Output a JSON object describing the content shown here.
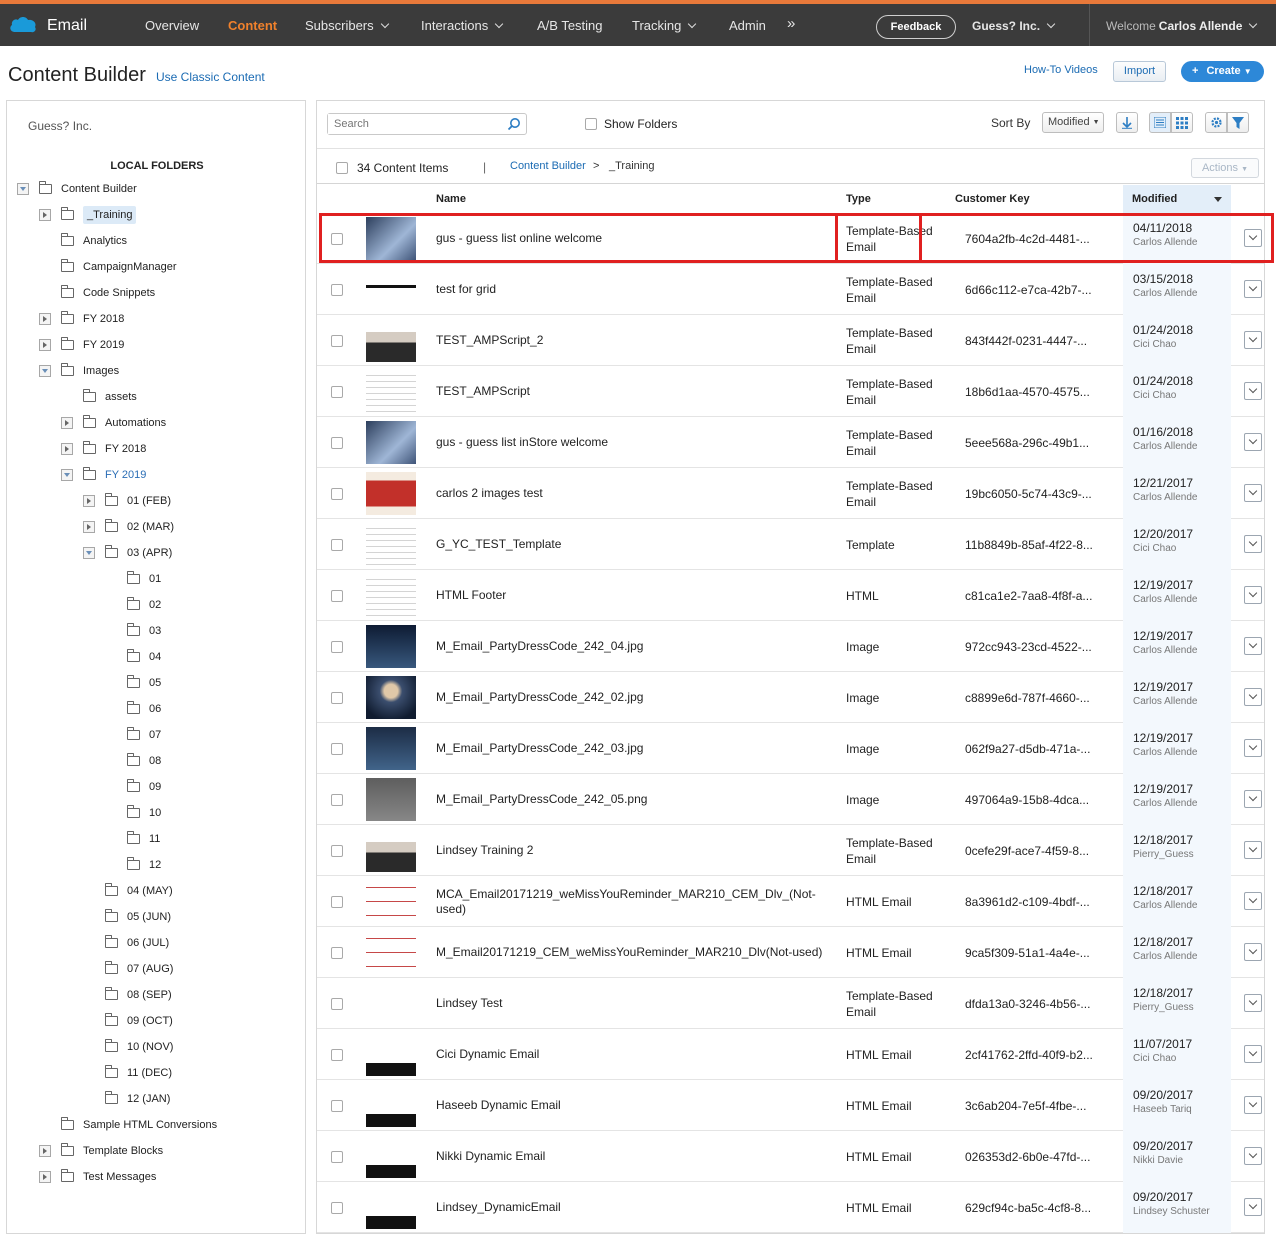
{
  "topnav": {
    "app_title": "Email",
    "items": [
      "Overview",
      "Content",
      "Subscribers",
      "Interactions",
      "A/B Testing",
      "Tracking",
      "Admin"
    ],
    "more": "»",
    "feedback": "Feedback",
    "org": "Guess? Inc.",
    "welcome_label": "Welcome",
    "user": "Carlos Allende",
    "active_color": "#f0812c"
  },
  "header": {
    "title": "Content Builder",
    "classic_link": "Use Classic Content",
    "howto": "How-To Videos",
    "import": "Import",
    "create": "Create",
    "create_icon": "+"
  },
  "sidebar": {
    "org": "Guess? Inc.",
    "heading": "LOCAL FOLDERS",
    "tree": [
      {
        "label": "Content Builder",
        "toggle": "open"
      },
      {
        "label": "_Training",
        "toggle": "closed",
        "selected": true
      },
      {
        "label": "Analytics",
        "toggle": "none"
      },
      {
        "label": "CampaignManager",
        "toggle": "none"
      },
      {
        "label": "Code Snippets",
        "toggle": "none"
      },
      {
        "label": "FY 2018",
        "toggle": "closed"
      },
      {
        "label": "FY 2019",
        "toggle": "closed"
      },
      {
        "label": "Images",
        "toggle": "open"
      },
      {
        "label": "assets",
        "toggle": "none"
      },
      {
        "label": "Automations",
        "toggle": "closed"
      },
      {
        "label": "FY 2018",
        "toggle": "closed"
      },
      {
        "label": "FY 2019",
        "toggle": "open",
        "highlight": true
      },
      {
        "label": "01 (FEB)",
        "toggle": "closed"
      },
      {
        "label": "02 (MAR)",
        "toggle": "closed"
      },
      {
        "label": "03 (APR)",
        "toggle": "open"
      },
      {
        "label": "01",
        "toggle": "none"
      },
      {
        "label": "02",
        "toggle": "none"
      },
      {
        "label": "03",
        "toggle": "none"
      },
      {
        "label": "04",
        "toggle": "none"
      },
      {
        "label": "05",
        "toggle": "none"
      },
      {
        "label": "06",
        "toggle": "none"
      },
      {
        "label": "07",
        "toggle": "none"
      },
      {
        "label": "08",
        "toggle": "none"
      },
      {
        "label": "09",
        "toggle": "none"
      },
      {
        "label": "10",
        "toggle": "none"
      },
      {
        "label": "11",
        "toggle": "none"
      },
      {
        "label": "12",
        "toggle": "none"
      },
      {
        "label": "04 (MAY)",
        "toggle": "none"
      },
      {
        "label": "05 (JUN)",
        "toggle": "none"
      },
      {
        "label": "06 (JUL)",
        "toggle": "none"
      },
      {
        "label": "07 (AUG)",
        "toggle": "none"
      },
      {
        "label": "08 (SEP)",
        "toggle": "none"
      },
      {
        "label": "09 (OCT)",
        "toggle": "none"
      },
      {
        "label": "10 (NOV)",
        "toggle": "none"
      },
      {
        "label": "11 (DEC)",
        "toggle": "none"
      },
      {
        "label": "12 (JAN)",
        "toggle": "none"
      },
      {
        "label": "Sample HTML Conversions",
        "toggle": "none"
      },
      {
        "label": "Template Blocks",
        "toggle": "closed"
      },
      {
        "label": "Test Messages",
        "toggle": "closed"
      }
    ]
  },
  "toolbar": {
    "search_placeholder": "Search",
    "show_folders": "Show Folders",
    "sort_by": "Sort By",
    "sort_value": "Modified"
  },
  "crumbs": {
    "count": "34 Content Items",
    "sep": "|",
    "root": "Content Builder",
    "arrow": ">",
    "current": "_Training",
    "actions": "Actions"
  },
  "columns": {
    "name": "Name",
    "type": "Type",
    "key": "Customer Key",
    "modified": "Modified"
  },
  "rows": [
    {
      "name": "gus - guess list online welcome",
      "type": "Template-Based Email",
      "key": "7604a2fb-4c2d-4481-...",
      "date": "04/11/2018",
      "user": "Carlos Allende",
      "thumb": "photo"
    },
    {
      "name": "test for grid",
      "type": "Template-Based Email",
      "key": "6d66c112-e7ca-42b7-...",
      "date": "03/15/2018",
      "user": "Carlos Allende",
      "thumb": "strip"
    },
    {
      "name": "TEST_AMPScript_2",
      "type": "Template-Based Email",
      "key": "843f442f-0231-4447-...",
      "date": "01/24/2018",
      "user": "Cici Chao",
      "thumb": "girl"
    },
    {
      "name": "TEST_AMPScript",
      "type": "Template-Based Email",
      "key": "18b6d1aa-4570-4575...",
      "date": "01/24/2018",
      "user": "Cici Chao",
      "thumb": "doc"
    },
    {
      "name": "gus - guess list inStore welcome",
      "type": "Template-Based Email",
      "key": "5eee568a-296c-49b1...",
      "date": "01/16/2018",
      "user": "Carlos Allende",
      "thumb": "photo"
    },
    {
      "name": "carlos 2 images test",
      "type": "Template-Based Email",
      "key": "19bc6050-5c74-43c9-...",
      "date": "12/21/2017",
      "user": "Carlos Allende",
      "thumb": "promo"
    },
    {
      "name": "G_YC_TEST_Template",
      "type": "Template",
      "key": "11b8849b-85af-4f22-8...",
      "date": "12/20/2017",
      "user": "Cici Chao",
      "thumb": "doc"
    },
    {
      "name": "HTML Footer",
      "type": "HTML",
      "key": "c81ca1e2-7aa8-4f8f-a...",
      "date": "12/19/2017",
      "user": "Carlos Allende",
      "thumb": "doc"
    },
    {
      "name": "M_Email_PartyDressCode_242_04.jpg",
      "type": "Image",
      "key": "972cc943-23cd-4522-...",
      "date": "12/19/2017",
      "user": "Carlos Allende",
      "thumb": "night"
    },
    {
      "name": "M_Email_PartyDressCode_242_02.jpg",
      "type": "Image",
      "key": "c8899e6d-787f-4660-...",
      "date": "12/19/2017",
      "user": "Carlos Allende",
      "thumb": "gown"
    },
    {
      "name": "M_Email_PartyDressCode_242_03.jpg",
      "type": "Image",
      "key": "062f9a27-d5db-471a-...",
      "date": "12/19/2017",
      "user": "Carlos Allende",
      "thumb": "script"
    },
    {
      "name": "M_Email_PartyDressCode_242_05.png",
      "type": "Image",
      "key": "497064a9-15b8-4dca...",
      "date": "12/19/2017",
      "user": "Carlos Allende",
      "thumb": "gray"
    },
    {
      "name": "Lindsey Training 2",
      "type": "Template-Based Email",
      "key": "0cefe29f-ace7-4f59-8...",
      "date": "12/18/2017",
      "user": "Pierry_Guess",
      "thumb": "girl"
    },
    {
      "name": "MCA_Email20171219_weMissYouReminder_MAR210_CEM_Dlv_(Not-used)",
      "type": "HTML Email",
      "key": "8a3961d2-c109-4bdf-...",
      "date": "12/18/2017",
      "user": "Carlos Allende",
      "thumb": "list"
    },
    {
      "name": "M_Email20171219_CEM_weMissYouReminder_MAR210_Dlv(Not-used)",
      "type": "HTML Email",
      "key": "9ca5f309-51a1-4a4e-...",
      "date": "12/18/2017",
      "user": "Carlos Allende",
      "thumb": "list"
    },
    {
      "name": "Lindsey Test",
      "type": "Template-Based Email",
      "key": "dfda13a0-3246-4b56-...",
      "date": "12/18/2017",
      "user": "Pierry_Guess",
      "thumb": "none"
    },
    {
      "name": "Cici Dynamic Email",
      "type": "HTML Email",
      "key": "2cf41762-2ffd-40f9-b2...",
      "date": "11/07/2017",
      "user": "Cici Chao",
      "thumb": "blackfoot"
    },
    {
      "name": "Haseeb Dynamic Email",
      "type": "HTML Email",
      "key": "3c6ab204-7e5f-4fbe-...",
      "date": "09/20/2017",
      "user": "Haseeb Tariq",
      "thumb": "blackfoot"
    },
    {
      "name": "Nikki Dynamic Email",
      "type": "HTML Email",
      "key": "026353d2-6b0e-47fd-...",
      "date": "09/20/2017",
      "user": "Nikki Davie",
      "thumb": "blackfoot"
    },
    {
      "name": "Lindsey_DynamicEmail",
      "type": "HTML Email",
      "key": "629cf94c-ba5c-4cf8-8...",
      "date": "09/20/2017",
      "user": "Lindsey Schuster",
      "thumb": "blackfoot"
    }
  ],
  "highlight_color": "#e02020"
}
